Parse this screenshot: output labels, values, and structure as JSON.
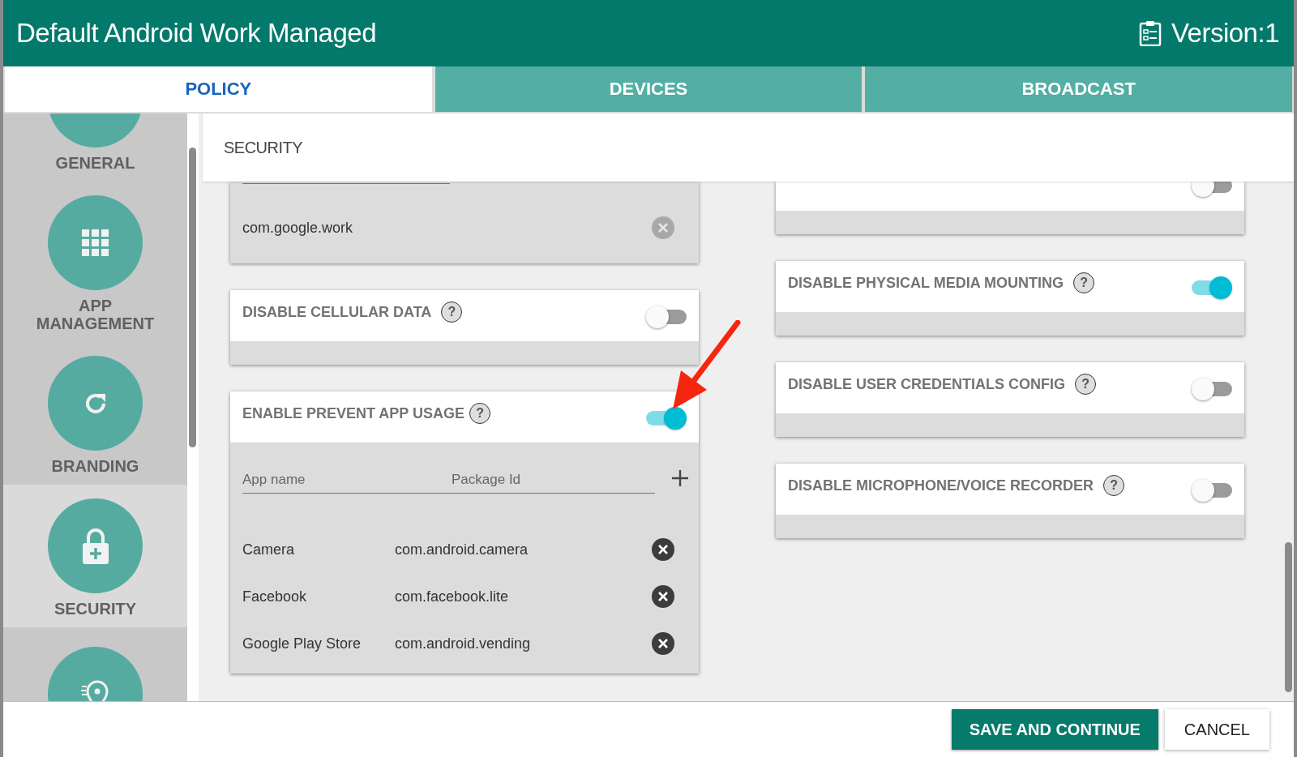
{
  "window": {
    "title": "Default Android Work Managed",
    "version": "Version:1"
  },
  "tabs": [
    {
      "label": "POLICY",
      "selected": true
    },
    {
      "label": "DEVICES",
      "selected": false
    },
    {
      "label": "BROADCAST",
      "selected": false
    }
  ],
  "sidebar": {
    "items": [
      {
        "label": "GENERAL",
        "selected": false
      },
      {
        "label": "APP MANAGEMENT",
        "selected": false
      },
      {
        "label": "BRANDING",
        "selected": false
      },
      {
        "label": "SECURITY",
        "selected": true
      },
      {
        "selected": false
      }
    ]
  },
  "section_title": "SECURITY",
  "left_cards": [
    {
      "kind": "list_tail",
      "rows": [
        {
          "value": "com.google.work",
          "disabled": true
        }
      ]
    },
    {
      "kind": "toggle",
      "title": "DISABLE CELLULAR DATA",
      "help": "?",
      "on": false
    },
    {
      "kind": "app_table",
      "title": "ENABLE PREVENT APP USAGE",
      "help": "?",
      "on": true,
      "columns": [
        "App name",
        "Package Id"
      ],
      "rows": [
        {
          "name": "Camera",
          "package": "com.android.camera",
          "disabled": false
        },
        {
          "name": "Facebook",
          "package": "com.facebook.lite",
          "disabled": false
        },
        {
          "name": "Google Play Store",
          "package": "com.android.vending",
          "disabled": false
        }
      ]
    }
  ],
  "right_cards": [
    {
      "kind": "clipped",
      "on": false
    },
    {
      "kind": "toggle",
      "title": "DISABLE PHYSICAL MEDIA MOUNTING",
      "help": "?",
      "on": true
    },
    {
      "kind": "toggle",
      "title": "DISABLE USER CREDENTIALS CONFIG",
      "help": "?",
      "on": false
    },
    {
      "kind": "toggle",
      "title": "DISABLE MICROPHONE/VOICE RECORDER",
      "help": "?",
      "on": false
    }
  ],
  "buttons": [
    {
      "label": "SAVE AND CONTINUE",
      "kind": "primary"
    },
    {
      "label": "CANCEL",
      "kind": "secondary"
    }
  ]
}
